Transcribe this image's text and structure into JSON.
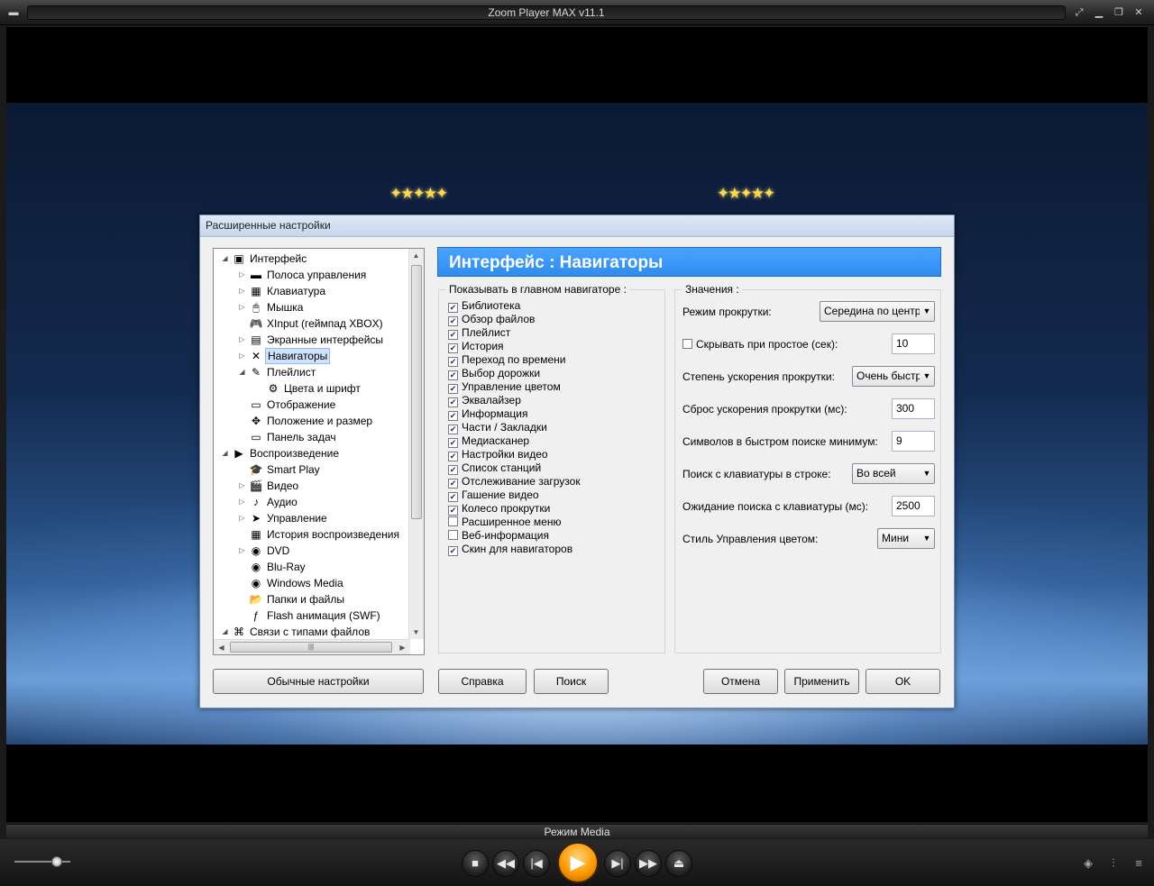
{
  "window": {
    "title": "Zoom Player MAX v11.1",
    "mode_label": "Режим Media"
  },
  "dialog": {
    "title": "Расширенные настройки",
    "panel_title": "Интерфейс : Навигаторы",
    "tree": [
      {
        "label": "Интерфейс",
        "icon": "interface-icon",
        "glyph": "▣"
      },
      {
        "label": "Полоса управления",
        "icon": "control-bar-icon",
        "glyph": "▬"
      },
      {
        "label": "Клавиатура",
        "icon": "keyboard-icon",
        "glyph": "▦"
      },
      {
        "label": "Мышка",
        "icon": "mouse-icon",
        "glyph": "🖱"
      },
      {
        "label": "XInput (геймпад XBOX)",
        "icon": "gamepad-icon",
        "glyph": "🎮"
      },
      {
        "label": "Экранные интерфейсы",
        "icon": "screen-interface-icon",
        "glyph": "▤"
      },
      {
        "label": "Навигаторы",
        "icon": "navigators-icon",
        "glyph": "✕"
      },
      {
        "label": "Плейлист",
        "icon": "playlist-icon",
        "glyph": "✎"
      },
      {
        "label": "Цвета и шрифт",
        "icon": "colors-fonts-icon",
        "glyph": "⚙"
      },
      {
        "label": "Отображение",
        "icon": "display-icon",
        "glyph": "▭"
      },
      {
        "label": "Положение и размер",
        "icon": "position-size-icon",
        "glyph": "✥"
      },
      {
        "label": "Панель задач",
        "icon": "taskbar-icon",
        "glyph": "▭"
      },
      {
        "label": "Воспроизведение",
        "icon": "playback-icon",
        "glyph": "▶"
      },
      {
        "label": "Smart Play",
        "icon": "smart-play-icon",
        "glyph": "🎓"
      },
      {
        "label": "Видео",
        "icon": "video-icon",
        "glyph": "🎬"
      },
      {
        "label": "Аудио",
        "icon": "audio-icon",
        "glyph": "♪"
      },
      {
        "label": "Управление",
        "icon": "control-icon",
        "glyph": "➤"
      },
      {
        "label": "История воспроизведения",
        "icon": "history-icon",
        "glyph": "▦"
      },
      {
        "label": "DVD",
        "icon": "dvd-icon",
        "glyph": "◉"
      },
      {
        "label": "Blu-Ray",
        "icon": "bluray-icon",
        "glyph": "◉"
      },
      {
        "label": "Windows Media",
        "icon": "windows-media-icon",
        "glyph": "◉"
      },
      {
        "label": "Папки и файлы",
        "icon": "folder-icon",
        "glyph": "📂"
      },
      {
        "label": "Flash анимация (SWF)",
        "icon": "flash-icon",
        "glyph": "ƒ"
      },
      {
        "label": "Связи с типами файлов",
        "icon": "file-associations-icon",
        "glyph": "⌘"
      }
    ],
    "show_group": {
      "title": "Показывать в главном навигаторе :",
      "items": [
        {
          "label": "Библиотека",
          "checked": true
        },
        {
          "label": "Обзор файлов",
          "checked": true
        },
        {
          "label": "Плейлист",
          "checked": true
        },
        {
          "label": "История",
          "checked": true
        },
        {
          "label": "Переход по времени",
          "checked": true
        },
        {
          "label": "Выбор дорожки",
          "checked": true
        },
        {
          "label": "Управление цветом",
          "checked": true
        },
        {
          "label": "Эквалайзер",
          "checked": true
        },
        {
          "label": "Информация",
          "checked": true
        },
        {
          "label": "Части / Закладки",
          "checked": true
        },
        {
          "label": "Медиасканер",
          "checked": true
        },
        {
          "label": "Настройки видео",
          "checked": true
        },
        {
          "label": "Список станций",
          "checked": true
        },
        {
          "label": "Отслеживание загрузок",
          "checked": true
        },
        {
          "label": "Гашение видео",
          "checked": true
        },
        {
          "label": "Колесо прокрутки",
          "checked": true
        },
        {
          "label": "Расширенное меню",
          "checked": false
        },
        {
          "label": "Веб-информация",
          "checked": false
        },
        {
          "label": "Скин для навигаторов",
          "checked": true
        }
      ]
    },
    "values_group": {
      "title": "Значения :",
      "scroll_mode_label": "Режим прокрутки:",
      "scroll_mode_value": "Середина по центру",
      "hide_idle_label": "Скрывать при простое (сек):",
      "hide_idle_checked": false,
      "hide_idle_value": "10",
      "scroll_accel_label": "Степень ускорения прокрутки:",
      "scroll_accel_value": "Очень быстро",
      "accel_reset_label": "Сброс ускорения прокрутки (мс):",
      "accel_reset_value": "300",
      "quick_search_label": "Символов в быстром поиске минимум:",
      "quick_search_value": "9",
      "kb_search_label": "Поиск с клавиатуры в строке:",
      "kb_search_value": "Во всей",
      "kb_wait_label": "Ожидание поиска с клавиатуры (мс):",
      "kb_wait_value": "2500",
      "color_style_label": "Стиль Управления цветом:",
      "color_style_value": "Мини"
    },
    "buttons": {
      "basic": "Обычные настройки",
      "help": "Справка",
      "search": "Поиск",
      "cancel": "Отмена",
      "apply": "Применить",
      "ok": "OK"
    }
  },
  "colors": {
    "header_blue": "#3898f8",
    "play_orange": "#ff9a00"
  }
}
